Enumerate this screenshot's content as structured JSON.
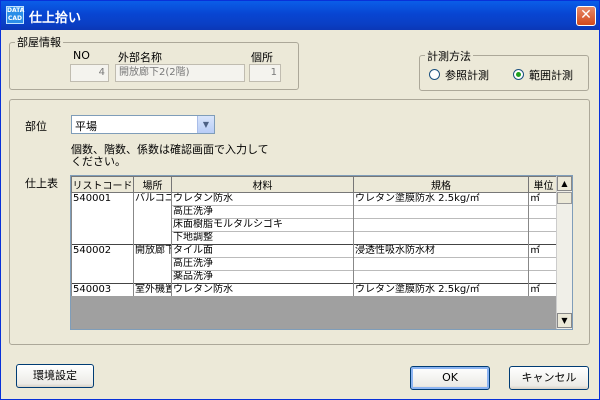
{
  "window": {
    "title": "仕上拾い",
    "app_icon_text": "DATA\nCAD"
  },
  "room_info": {
    "legend": "部屋情報",
    "no_label": "NO",
    "no_value": "4",
    "name_label": "外部名称",
    "name_value": "開放廊下2(2階)",
    "count_label": "個所",
    "count_value": "1"
  },
  "measure_method": {
    "legend": "計測方法",
    "options": [
      "参照計測",
      "範囲計測"
    ],
    "selected": "範囲計測"
  },
  "part": {
    "label": "部位",
    "value": "平場"
  },
  "note": "個数、階数、係数は確認画面で入力してください。",
  "finish_table": {
    "label": "仕上表",
    "columns": [
      "リストコード",
      "場所",
      "材料",
      "規格",
      "単位"
    ],
    "rows": [
      {
        "code": "540001",
        "place": "バルコニー",
        "material": "ウレタン防水",
        "spec": "ウレタン塗膜防水 2.5kg/㎡",
        "unit": "㎡"
      },
      {
        "code": "",
        "place": "",
        "material": "高圧洗浄",
        "spec": "",
        "unit": ""
      },
      {
        "code": "",
        "place": "",
        "material": "床面樹脂モルタルシゴキ",
        "spec": "",
        "unit": ""
      },
      {
        "code": "",
        "place": "",
        "material": "下地調整",
        "spec": "",
        "unit": ""
      },
      {
        "code": "540002",
        "place": "開放廊下",
        "material": "タイル面",
        "spec": "浸透性吸水防水材",
        "unit": "㎡"
      },
      {
        "code": "",
        "place": "",
        "material": "高圧洗浄",
        "spec": "",
        "unit": ""
      },
      {
        "code": "",
        "place": "",
        "material": "薬品洗浄",
        "spec": "",
        "unit": ""
      },
      {
        "code": "540003",
        "place": "室外機置場",
        "material": "ウレタン防水",
        "spec": "ウレタン塗膜防水 2.5kg/㎡",
        "unit": "㎡"
      }
    ]
  },
  "buttons": {
    "env_settings": "環境設定",
    "ok": "OK",
    "cancel": "キャンセル"
  }
}
